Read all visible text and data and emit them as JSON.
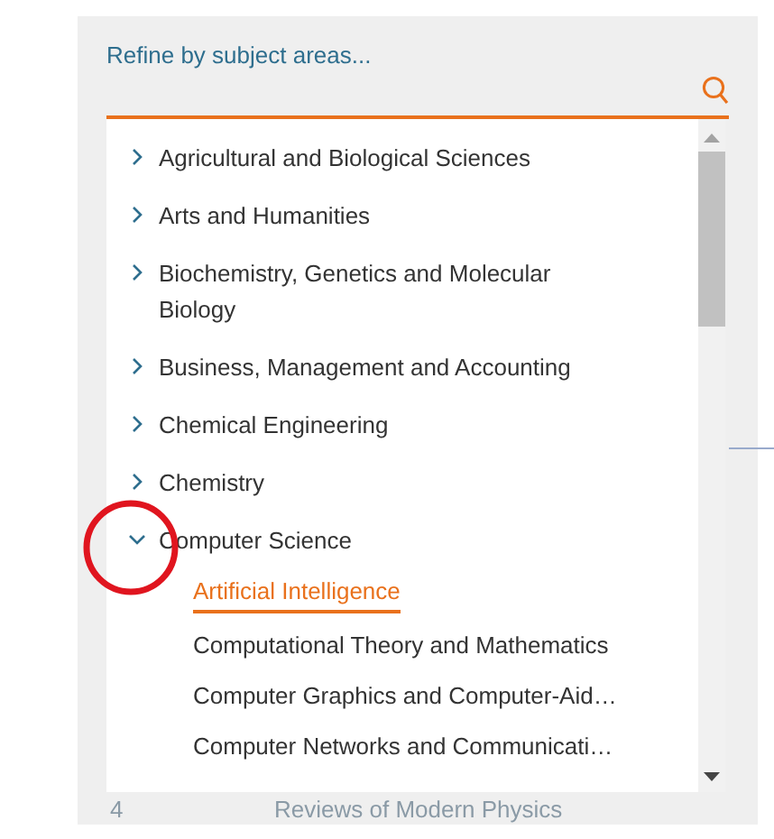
{
  "filter": {
    "placeholder": "Refine by subject areas...",
    "items": [
      {
        "label": "Agricultural and Biological Sciences",
        "expanded": false
      },
      {
        "label": "Arts and Humanities",
        "expanded": false
      },
      {
        "label": "Biochemistry, Genetics and Molecular Biology",
        "expanded": false
      },
      {
        "label": "Business, Management and Accounting",
        "expanded": false
      },
      {
        "label": "Chemical Engineering",
        "expanded": false
      },
      {
        "label": "Chemistry",
        "expanded": false
      },
      {
        "label": "Computer Science",
        "expanded": true,
        "children": [
          {
            "label": "Artificial Intelligence",
            "selected": true
          },
          {
            "label": "Computational Theory and Mathematics",
            "selected": false
          },
          {
            "label": "Computer Graphics and Computer-Aid…",
            "selected": false
          },
          {
            "label": "Computer Networks and Communicati…",
            "selected": false
          }
        ]
      }
    ]
  },
  "background_row": {
    "rank": "4",
    "title": "Reviews of Modern Physics"
  },
  "annotation": {
    "kind": "circle"
  }
}
